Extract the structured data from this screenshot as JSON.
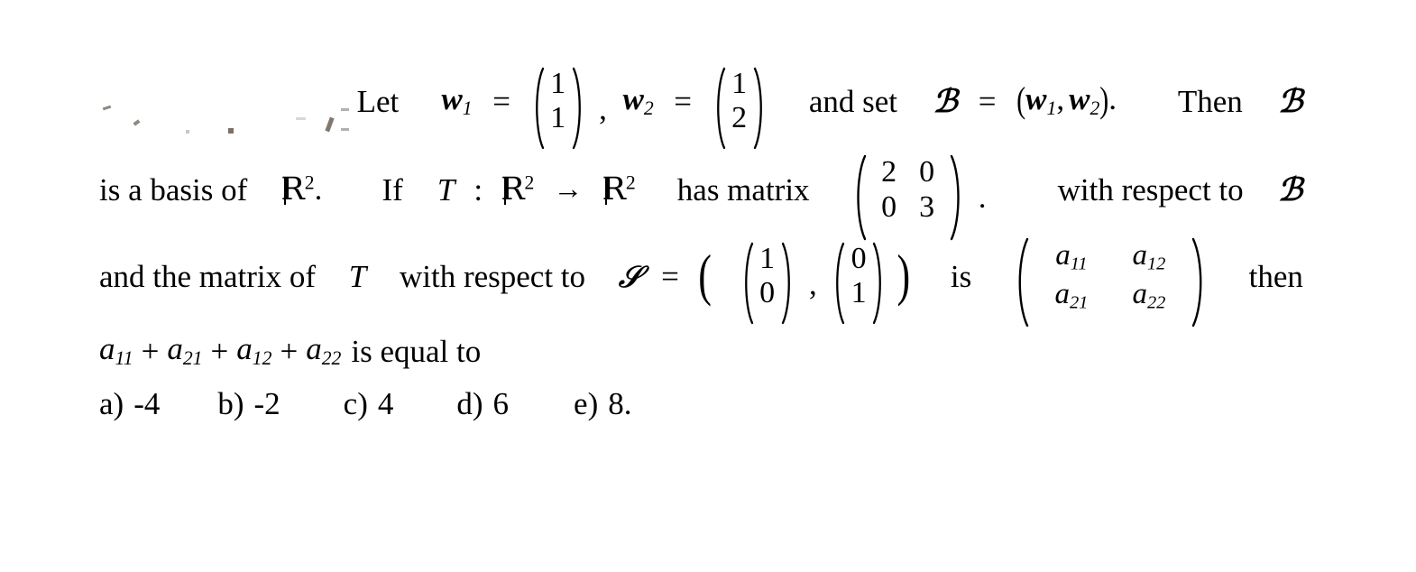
{
  "document": {
    "type": "math-multiple-choice-question",
    "topic": "linear algebra change of basis"
  },
  "line1": {
    "lead_text": "Let",
    "vector1_name": "w",
    "vector1_sub": "1",
    "equals": "=",
    "vector1_values": [
      "1",
      "1"
    ],
    "comma": ",",
    "vector2_name": "w",
    "vector2_sub": "2",
    "vector2_values": [
      "1",
      "2"
    ],
    "and_set": "and set",
    "basis_B": "ℬ",
    "basis_def_open": "(",
    "basis_def": "w₁, w₂",
    "basis_def_close": ").",
    "then": "Then",
    "then_B": "ℬ",
    "w1_label": "w",
    "w1_sub": "1",
    "w2_label": "w",
    "w2_sub": "2"
  },
  "line2": {
    "is_a_basis_of": "is a basis of",
    "R": "R",
    "exp2": "2",
    "period": ".",
    "if": "If",
    "T": "T",
    "colon": ":",
    "arrow": "→",
    "has_matrix": "has matrix",
    "matrix_values": [
      [
        "2",
        "0"
      ],
      [
        "0",
        "3"
      ]
    ],
    "matrix_period": ".",
    "with_respect_to": "with respect to",
    "basis_B": "ℬ"
  },
  "line3": {
    "and_the_matrix_of": "and the matrix of",
    "T": "T",
    "with_respect_to": "with respect to",
    "basis_S": "𝒮",
    "equals": "=",
    "open_paren": "(",
    "vector1_values": [
      "1",
      "0"
    ],
    "comma": ",",
    "vector2_values": [
      "0",
      "1"
    ],
    "close_paren": ")",
    "is": "is",
    "matrix_entries": [
      [
        "a",
        "a"
      ],
      [
        "a",
        "a"
      ]
    ],
    "matrix_subs": [
      [
        "11",
        "12"
      ],
      [
        "21",
        "22"
      ]
    ],
    "then": "then"
  },
  "line4": {
    "terms": [
      {
        "base": "a",
        "sub": "11"
      },
      {
        "base": "a",
        "sub": "21"
      },
      {
        "base": "a",
        "sub": "12"
      },
      {
        "base": "a",
        "sub": "22"
      }
    ],
    "plus": "+",
    "is_equal_to": "is equal to"
  },
  "options": [
    {
      "label": "a)",
      "value": "-4"
    },
    {
      "label": "b)",
      "value": "-2"
    },
    {
      "label": "c)",
      "value": "4"
    },
    {
      "label": "d)",
      "value": "6"
    },
    {
      "label": "e)",
      "value": "8."
    }
  ],
  "colors": {
    "background": "#ffffff",
    "text": "#000000",
    "artifact": "#6b6257"
  }
}
